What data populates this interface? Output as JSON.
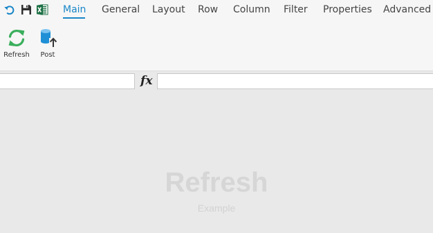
{
  "quick_access": {
    "undo_icon": "undo-icon",
    "save_icon": "save-icon",
    "excel_icon": "excel-icon"
  },
  "tabs": [
    {
      "label": "Main",
      "active": true
    },
    {
      "label": "General",
      "active": false
    },
    {
      "label": "Layout",
      "active": false
    },
    {
      "label": "Row",
      "active": false
    },
    {
      "label": "Column",
      "active": false
    },
    {
      "label": "Filter",
      "active": false
    },
    {
      "label": "Properties",
      "active": false
    },
    {
      "label": "Advanced",
      "active": false
    }
  ],
  "ribbon": {
    "refresh": {
      "label": "Refresh",
      "icon": "refresh-icon"
    },
    "post": {
      "label": "Post",
      "icon": "database-upload-icon"
    }
  },
  "formula_bar": {
    "name_box_value": "",
    "fx_label": "fx",
    "formula_value": ""
  },
  "watermark": {
    "title": "Refresh",
    "subtitle": "Example"
  },
  "colors": {
    "accent": "#1a86c8",
    "refresh_green": "#3aae5c",
    "db_blue": "#1f8fd6",
    "excel_green": "#1d7044"
  }
}
